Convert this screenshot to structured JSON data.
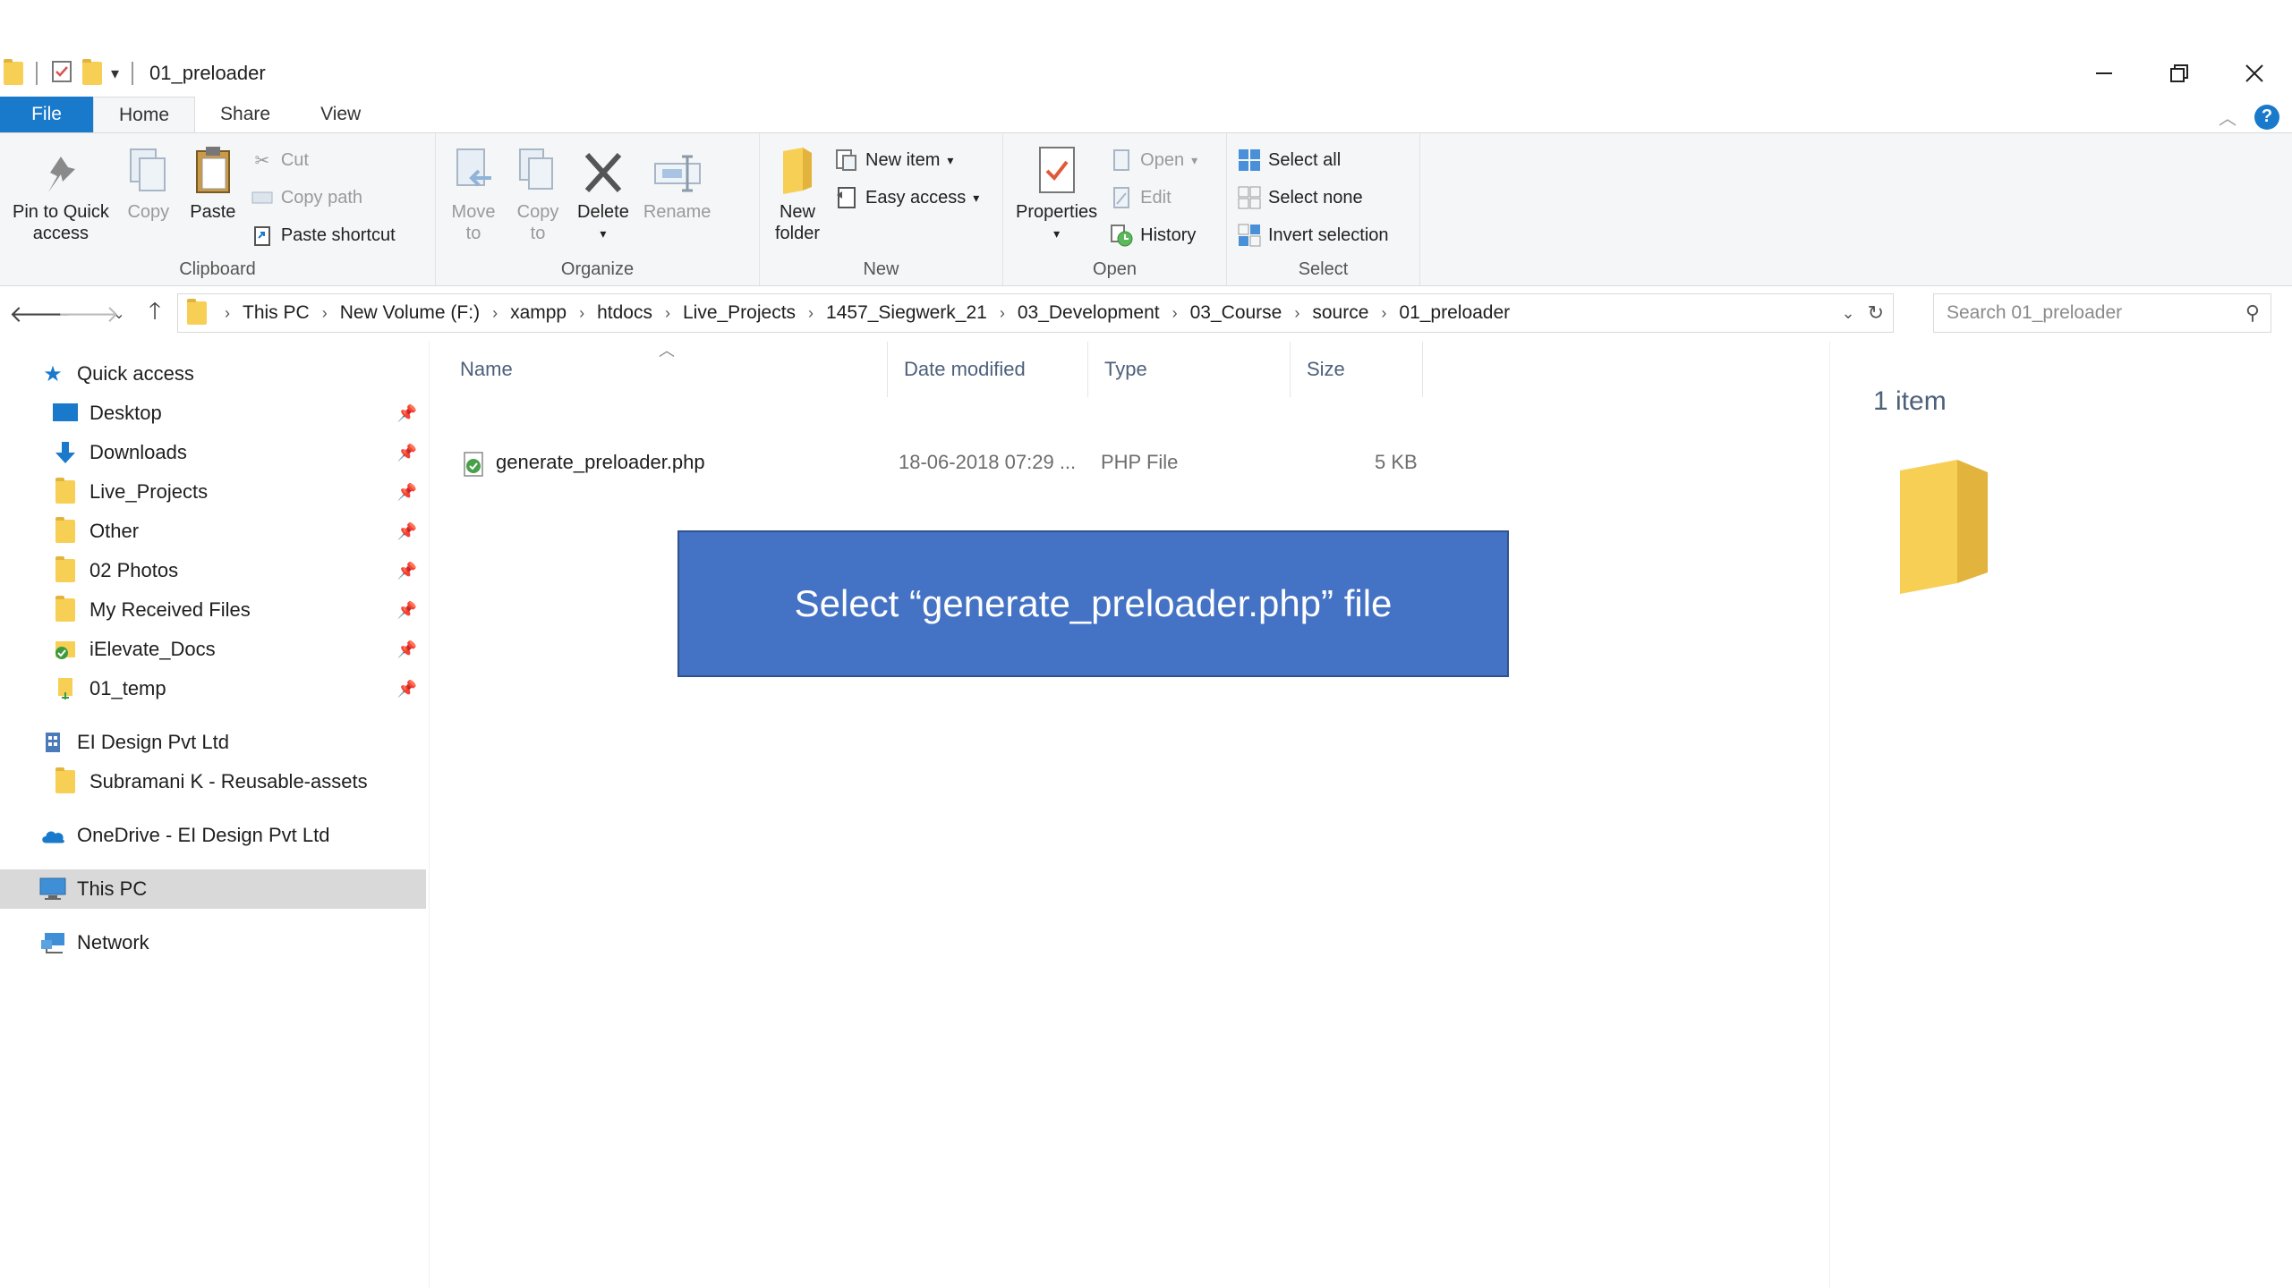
{
  "window": {
    "title": "01_preloader",
    "controls": [
      "minimize",
      "restore",
      "close"
    ]
  },
  "tabs": [
    {
      "label": "File"
    },
    {
      "label": "Home"
    },
    {
      "label": "Share"
    },
    {
      "label": "View"
    }
  ],
  "ribbon": {
    "clipboard": {
      "label": "Clipboard",
      "pin_line1": "Pin to Quick",
      "pin_line2": "access",
      "copy": "Copy",
      "paste": "Paste",
      "cut": "Cut",
      "copy_path": "Copy path",
      "paste_shortcut": "Paste shortcut"
    },
    "organize": {
      "label": "Organize",
      "move_line1": "Move",
      "move_line2": "to",
      "copy_line1": "Copy",
      "copy_line2": "to",
      "delete": "Delete",
      "rename": "Rename"
    },
    "new": {
      "label": "New",
      "new_folder_line1": "New",
      "new_folder_line2": "folder",
      "new_item": "New item",
      "easy_access": "Easy access"
    },
    "open": {
      "label": "Open",
      "properties": "Properties",
      "open": "Open",
      "edit": "Edit",
      "history": "History"
    },
    "select": {
      "label": "Select",
      "select_all": "Select all",
      "select_none": "Select none",
      "invert_selection": "Invert selection"
    }
  },
  "address": {
    "crumbs": [
      "This PC",
      "New Volume (F:)",
      "xampp",
      "htdocs",
      "Live_Projects",
      "1457_Siegwerk_21",
      "03_Development",
      "03_Course",
      "source",
      "01_preloader"
    ]
  },
  "search": {
    "placeholder": "Search 01_preloader"
  },
  "nav": {
    "quick_access": "Quick access",
    "items": [
      {
        "label": "Desktop"
      },
      {
        "label": "Downloads"
      },
      {
        "label": "Live_Projects"
      },
      {
        "label": "Other"
      },
      {
        "label": "02 Photos"
      },
      {
        "label": "My Received Files"
      },
      {
        "label": "iElevate_Docs"
      },
      {
        "label": "01_temp"
      }
    ],
    "el_design": "EI Design Pvt Ltd",
    "subramani": "Subramani K - Reusable-assets",
    "onedrive": "OneDrive - EI Design Pvt Ltd",
    "this_pc": "This PC",
    "network": "Network"
  },
  "columns": {
    "name": "Name",
    "date": "Date modified",
    "type": "Type",
    "size": "Size"
  },
  "files": [
    {
      "name": "generate_preloader.php",
      "date": "18-06-2018 07:29 ...",
      "type": "PHP File",
      "size": "5 KB"
    }
  ],
  "details": {
    "count": "1 item"
  },
  "callout": {
    "text": "Select “generate_preloader.php” file",
    "color": "#4472c4"
  },
  "colors": {
    "accent": "#1979ca",
    "folder": "#f8cf55"
  }
}
